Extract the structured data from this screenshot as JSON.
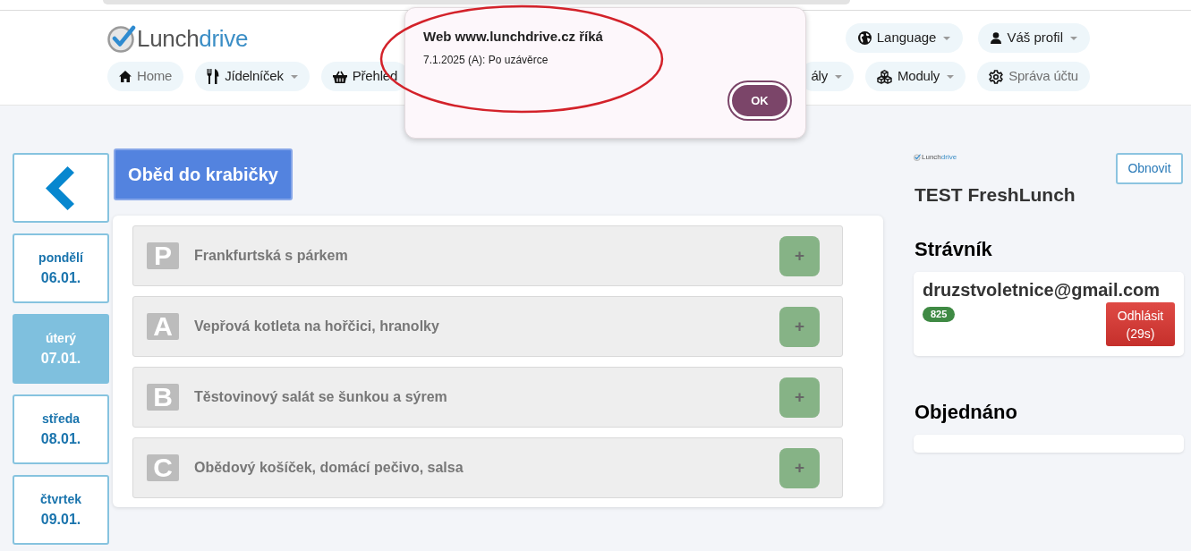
{
  "header": {
    "logo": {
      "parts": [
        "Lunch",
        "drive"
      ]
    },
    "top_menu": [
      {
        "label": "Language",
        "dropdown": true
      },
      {
        "label": "Váš profil",
        "dropdown": true
      }
    ],
    "nav": [
      {
        "label": "Home",
        "dropdown": false,
        "dimmed": true
      },
      {
        "label": "Jídelníček",
        "dropdown": true,
        "dimmed": false
      },
      {
        "label": "Přehled",
        "dropdown": false,
        "dimmed": false
      },
      {
        "label": "ály",
        "dropdown": true,
        "dimmed": false
      },
      {
        "label": "Moduly",
        "dropdown": true,
        "dimmed": false
      },
      {
        "label": "Správa účtu",
        "dropdown": false,
        "dimmed": true
      }
    ]
  },
  "dialog": {
    "title": "Web www.lunchdrive.cz říká",
    "message": "7.1.2025 (A): Po uzávěrce",
    "button": "OK"
  },
  "days": [
    {
      "day": "pondělí",
      "date": "06.01.",
      "selected": false
    },
    {
      "day": "úterý",
      "date": "07.01.",
      "selected": true
    },
    {
      "day": "středa",
      "date": "08.01.",
      "selected": false
    },
    {
      "day": "čtvrtek",
      "date": "09.01.",
      "selected": false
    }
  ],
  "category_button": "Oběd do krabičky",
  "menu_items": [
    {
      "letter": "P",
      "name": "Frankfurtská s párkem",
      "add": "+"
    },
    {
      "letter": "A",
      "name": "Vepřová kotleta na hořčici, hranolky",
      "add": "+"
    },
    {
      "letter": "B",
      "name": "Těstovinový salát se šunkou a sýrem",
      "add": "+"
    },
    {
      "letter": "C",
      "name": "Obědový košíček, domácí pečivo, salsa",
      "add": "+"
    }
  ],
  "sidebar": {
    "logo": {
      "parts": [
        "Lunch",
        "drive"
      ]
    },
    "refresh_button": "Obnovit",
    "canteen": "TEST FreshLunch",
    "diner_heading": "Strávník",
    "diner": {
      "email": "druzstvoletnice@gmail.com",
      "badge": "825",
      "logout_button": "Odhlásit (29s)"
    },
    "orders_heading": "Objednáno"
  },
  "annotations": [
    {
      "kind": "ellipse"
    }
  ]
}
